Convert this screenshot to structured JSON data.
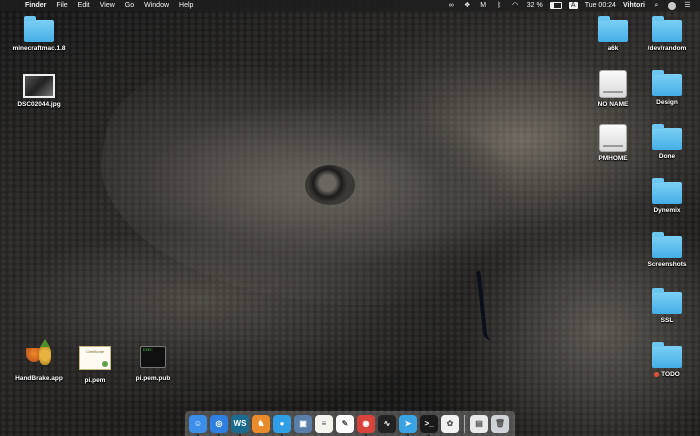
{
  "menubar": {
    "apple_glyph": "",
    "app_name": "Finder",
    "menus": [
      "File",
      "Edit",
      "View",
      "Go",
      "Window",
      "Help"
    ],
    "battery_percent": "32 %",
    "input_source": "A",
    "clock": "Tue 00:24",
    "user": "Vihtori"
  },
  "desktop_left": [
    {
      "label": "minecraftmac.1.8",
      "icon": "folder-icon"
    },
    {
      "label": "DSC02044.jpg",
      "icon": "photo-icon"
    }
  ],
  "desktop_bottom": [
    {
      "label": "HandBrake.app",
      "icon": "handbrake-icon"
    },
    {
      "label": "pi.pem",
      "icon": "certificate-icon"
    },
    {
      "label": "pi.pem.pub",
      "icon": "terminal-document-icon"
    }
  ],
  "desktop_right": [
    {
      "label": "a6k",
      "icon": "folder-icon"
    },
    {
      "label": "/dev/random",
      "icon": "folder-icon"
    },
    {
      "label": "NO NAME",
      "icon": "drive-icon"
    },
    {
      "label": "Design",
      "icon": "folder-icon"
    },
    {
      "label": "PMHOME",
      "icon": "drive-icon"
    },
    {
      "label": "Done",
      "icon": "folder-icon"
    },
    {
      "label": "Dynemix",
      "icon": "folder-icon"
    },
    {
      "label": "Screenshots",
      "icon": "folder-icon"
    },
    {
      "label": "SSL",
      "icon": "folder-icon"
    },
    {
      "label": "TODO",
      "icon": "folder-icon",
      "tag_color": "#e0513c"
    }
  ],
  "dock": {
    "apps": [
      {
        "name": "finder-icon",
        "color": "#3c8ee8",
        "glyph": "☺"
      },
      {
        "name": "safari-icon",
        "color": "#2f7fe0",
        "glyph": "◎"
      },
      {
        "name": "webstorm-icon",
        "color": "#1b6a8f",
        "glyph": "WS"
      },
      {
        "name": "transmit-icon",
        "color": "#e98a2b",
        "glyph": "♞"
      },
      {
        "name": "maps-pin-icon",
        "color": "#2f9ee6",
        "glyph": "●"
      },
      {
        "name": "preview-icon",
        "color": "#5b7fa8",
        "glyph": "▣"
      },
      {
        "name": "notes-icon",
        "color": "#f5f5f0",
        "glyph": "≡"
      },
      {
        "name": "textedit-icon",
        "color": "#ffffff",
        "glyph": "✎"
      },
      {
        "name": "chrome-icon",
        "color": "#d9433b",
        "glyph": "◉"
      },
      {
        "name": "activity-monitor-icon",
        "color": "#222222",
        "glyph": "∿"
      },
      {
        "name": "telegram-icon",
        "color": "#3aa3e3",
        "glyph": "➤"
      },
      {
        "name": "terminal-icon",
        "color": "#1a1a1a",
        "glyph": ">_"
      },
      {
        "name": "photos-icon",
        "color": "#f2f2f2",
        "glyph": "✿"
      }
    ],
    "trailing": [
      {
        "name": "document-stack-icon",
        "color": "#e9e9e9",
        "glyph": "▤"
      },
      {
        "name": "trash-icon",
        "color": "#cfd2d6",
        "glyph": "🗑"
      }
    ]
  }
}
